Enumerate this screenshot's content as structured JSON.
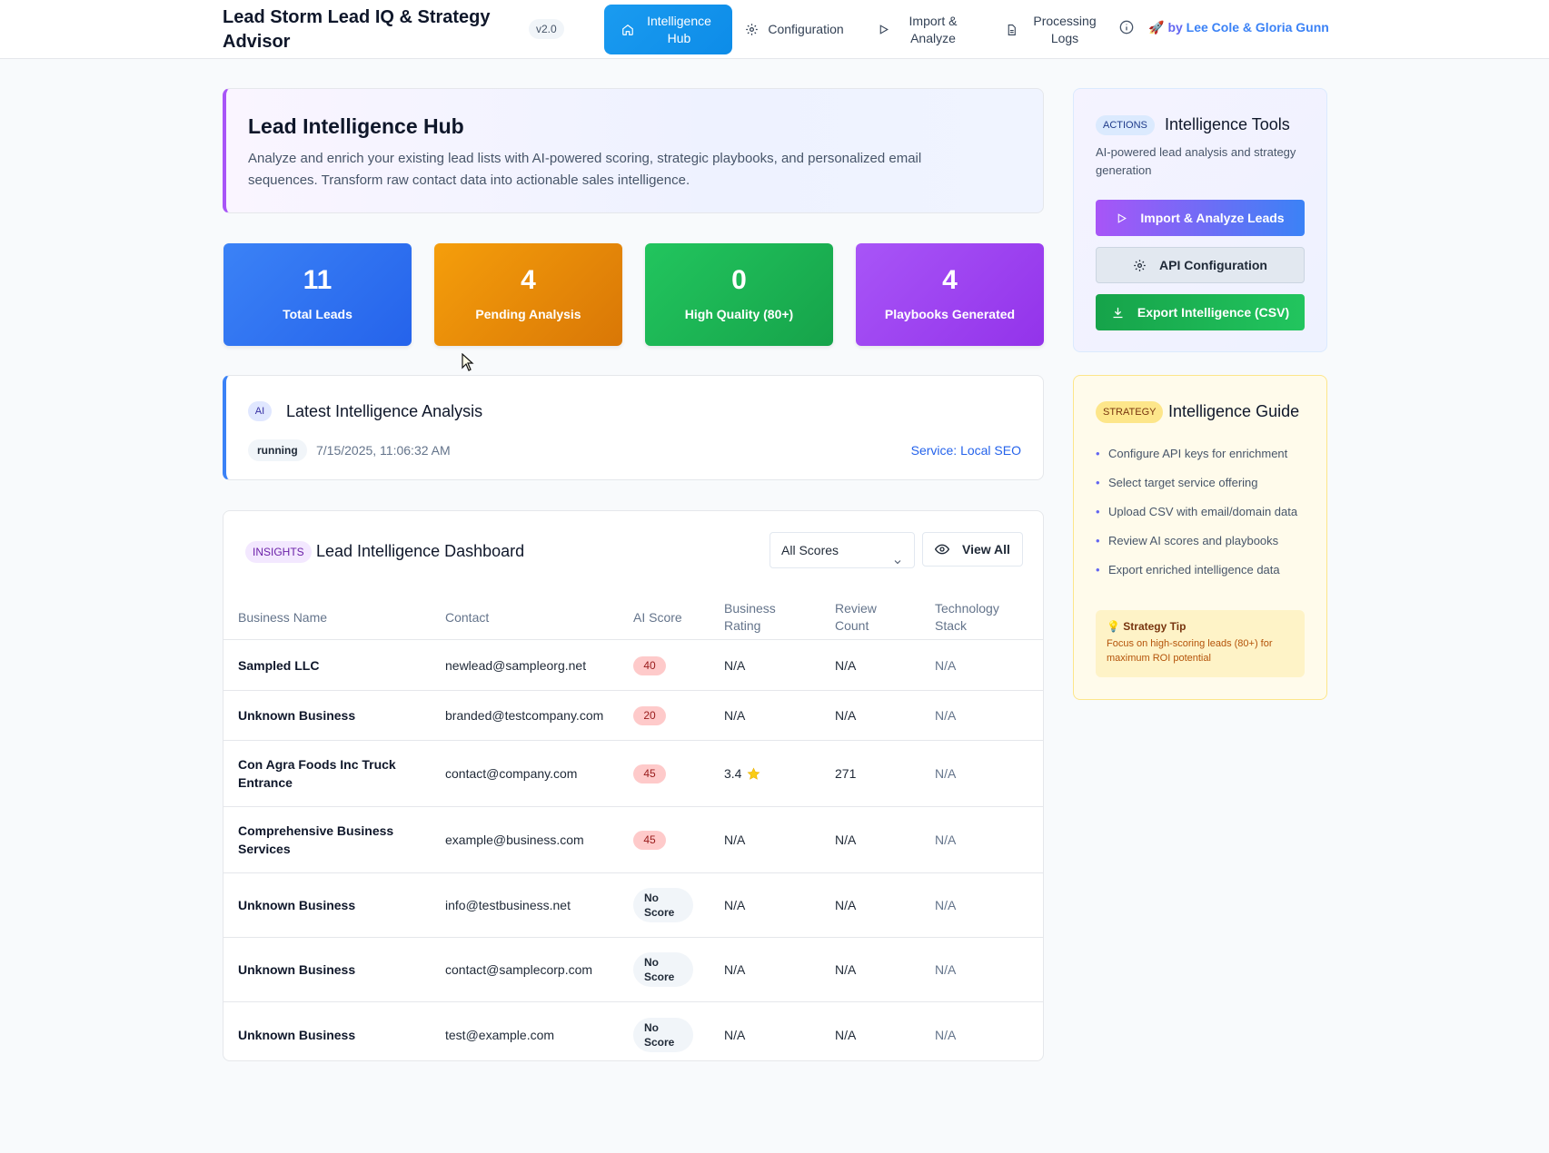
{
  "header": {
    "brand": "Lead Storm Lead IQ & Strategy Advisor",
    "version": "v2.0",
    "nav": [
      {
        "label": "Intelligence Hub",
        "icon": "home-icon",
        "active": true
      },
      {
        "label": "Configuration",
        "icon": "gear-icon",
        "active": false
      },
      {
        "label": "Import & Analyze",
        "icon": "play-icon",
        "active": false
      },
      {
        "label": "Processing Logs",
        "icon": "document-icon",
        "active": false
      }
    ],
    "credit_prefix": "by",
    "credit_names": "Lee Cole & Gloria Gunn"
  },
  "hero": {
    "title": "Lead Intelligence Hub",
    "description": "Analyze and enrich your existing lead lists with AI-powered scoring, strategic playbooks, and personalized email sequences. Transform raw contact data into actionable sales intelligence."
  },
  "stats": [
    {
      "value": "11",
      "label": "Total Leads",
      "color": "#2563eb"
    },
    {
      "value": "4",
      "label": "Pending Analysis",
      "color": "#d97706"
    },
    {
      "value": "0",
      "label": "High Quality (80+)",
      "color": "#16a34a"
    },
    {
      "value": "4",
      "label": "Playbooks Generated",
      "color": "#9333ea"
    }
  ],
  "analysis": {
    "badge": "AI",
    "title": "Latest Intelligence Analysis",
    "status": "running",
    "timestamp": "7/15/2025, 11:06:32 AM",
    "service": "Service: Local SEO"
  },
  "dashboard": {
    "badge": "INSIGHTS",
    "title": "Lead Intelligence Dashboard",
    "filter_value": "All Scores",
    "view_all_label": "View All",
    "columns": [
      "Business Name",
      "Contact",
      "AI Score",
      "Business Rating",
      "Review Count",
      "Technology Stack"
    ],
    "rows": [
      {
        "name": "Sampled LLC",
        "contact": "newlead@sampleorg.net",
        "score": "40",
        "rating": "N/A",
        "reviews": "N/A",
        "tech": "N/A"
      },
      {
        "name": "Unknown Business",
        "contact": "branded@testcompany.com",
        "score": "20",
        "rating": "N/A",
        "reviews": "N/A",
        "tech": "N/A"
      },
      {
        "name": "Con Agra Foods Inc Truck Entrance",
        "contact": "contact@company.com",
        "score": "45",
        "rating": "3.4",
        "reviews": "271",
        "tech": "N/A"
      },
      {
        "name": "Comprehensive Business Services",
        "contact": "example@business.com",
        "score": "45",
        "rating": "N/A",
        "reviews": "N/A",
        "tech": "N/A"
      },
      {
        "name": "Unknown Business",
        "contact": "info@testbusiness.net",
        "score": "No Score",
        "rating": "N/A",
        "reviews": "N/A",
        "tech": "N/A"
      },
      {
        "name": "Unknown Business",
        "contact": "contact@samplecorp.com",
        "score": "No Score",
        "rating": "N/A",
        "reviews": "N/A",
        "tech": "N/A"
      },
      {
        "name": "Unknown Business",
        "contact": "test@example.com",
        "score": "No Score",
        "rating": "N/A",
        "reviews": "N/A",
        "tech": "N/A"
      }
    ]
  },
  "tools": {
    "badge": "ACTIONS",
    "title": "Intelligence Tools",
    "description": "AI-powered lead analysis and strategy generation",
    "buttons": [
      "Import & Analyze Leads",
      "API Configuration",
      "Export Intelligence (CSV)"
    ]
  },
  "guide": {
    "badge": "STRATEGY",
    "title": "Intelligence Guide",
    "steps": [
      "Configure API keys for enrichment",
      "Select target service offering",
      "Upload CSV with email/domain data",
      "Review AI scores and playbooks",
      "Export enriched intelligence data"
    ],
    "tip_title": "Strategy Tip",
    "tip_text": "Focus on high-scoring leads (80+) for maximum ROI potential"
  }
}
